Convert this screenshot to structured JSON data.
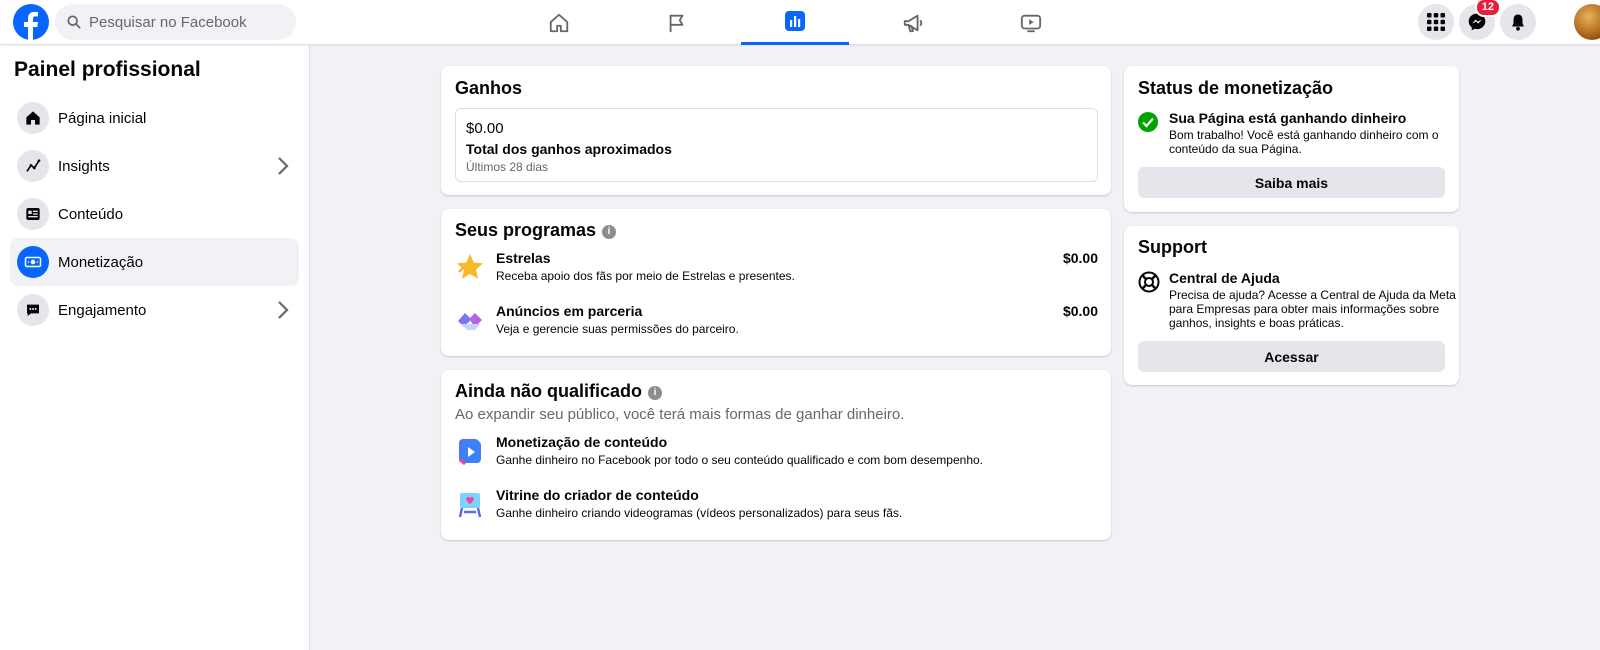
{
  "topbar": {
    "search_placeholder": "Pesquisar no Facebook",
    "notifications_badge": "12",
    "nav_tabs": [
      {
        "icon": "home-icon"
      },
      {
        "icon": "flag-icon"
      },
      {
        "icon": "chart-icon",
        "active": true
      },
      {
        "icon": "megaphone-icon"
      },
      {
        "icon": "video-icon"
      }
    ]
  },
  "sidebar": {
    "title": "Painel profissional",
    "items": [
      {
        "label": "Página inicial",
        "icon": "home-icon"
      },
      {
        "label": "Insights",
        "icon": "insights-icon"
      },
      {
        "label": "Conteúdo",
        "icon": "content-icon"
      },
      {
        "label": "Monetização",
        "icon": "monetization-icon"
      },
      {
        "label": "Engajamento",
        "icon": "chat-icon"
      }
    ]
  },
  "earnings": {
    "title": "Ganhos",
    "amount": "$0.00",
    "label": "Total dos ganhos aproximados",
    "period": "Últimos 28 dias"
  },
  "programs": {
    "title": "Seus programas",
    "items": [
      {
        "title": "Estrelas",
        "desc": "Receba apoio dos fãs por meio de Estrelas e presentes.",
        "amount": "$0.00"
      },
      {
        "title": "Anúncios em parceria",
        "desc": "Veja e gerencie suas permissões do parceiro.",
        "amount": "$0.00"
      }
    ]
  },
  "not_qualified": {
    "title": "Ainda não qualificado",
    "subtitle": "Ao expandir seu público, você terá mais formas de ganhar dinheiro.",
    "items": [
      {
        "title": "Monetização de conteúdo",
        "desc": "Ganhe dinheiro no Facebook por todo o seu conteúdo qualificado e com bom desempenho."
      },
      {
        "title": "Vitrine do criador de conteúdo",
        "desc": "Ganhe dinheiro criando videogramas (vídeos personalizados) para seus fãs."
      }
    ]
  },
  "status": {
    "title": "Status de monetização",
    "headline": "Sua Página está ganhando dinheiro",
    "desc_line1": "Bom trabalho! Você está ganhando dinheiro com o",
    "desc_line2": "conteúdo da sua Página.",
    "button": "Saiba mais"
  },
  "support": {
    "title": "Support",
    "headline": "Central de Ajuda",
    "desc_line1": "Precisa de ajuda? Acesse a Central de Ajuda da Meta",
    "desc_line2": "para Empresas para obter mais informações sobre",
    "desc_line3": "ganhos, insights e boas práticas.",
    "button": "Acessar"
  },
  "colors": {
    "brand": "#0866ff",
    "success": "#00a400",
    "badge": "#e41e3f"
  }
}
